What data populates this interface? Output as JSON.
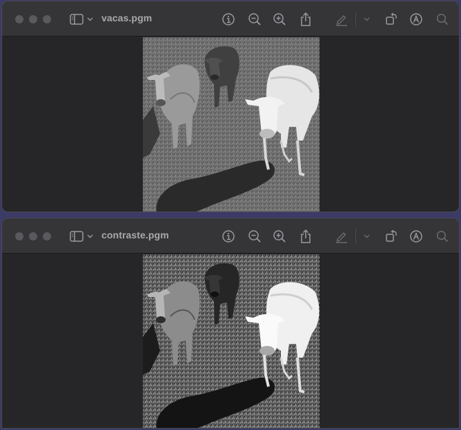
{
  "windows": [
    {
      "title": "vacas.pgm",
      "image_variant": "original"
    },
    {
      "title": "contraste.pgm",
      "image_variant": "high-contrast"
    }
  ],
  "toolbar_icons": [
    "sidebar-toggle-icon",
    "chevron-down-icon",
    "info-icon",
    "zoom-out-icon",
    "zoom-in-icon",
    "share-icon",
    "markup-pen-icon",
    "chevron-down-icon",
    "rotate-icon",
    "annotate-icon",
    "search-icon"
  ],
  "colors": {
    "desktop": "#3c3a66",
    "titlebar": "#353538",
    "window_bg": "#262628",
    "icon": "#9a9aa0"
  }
}
